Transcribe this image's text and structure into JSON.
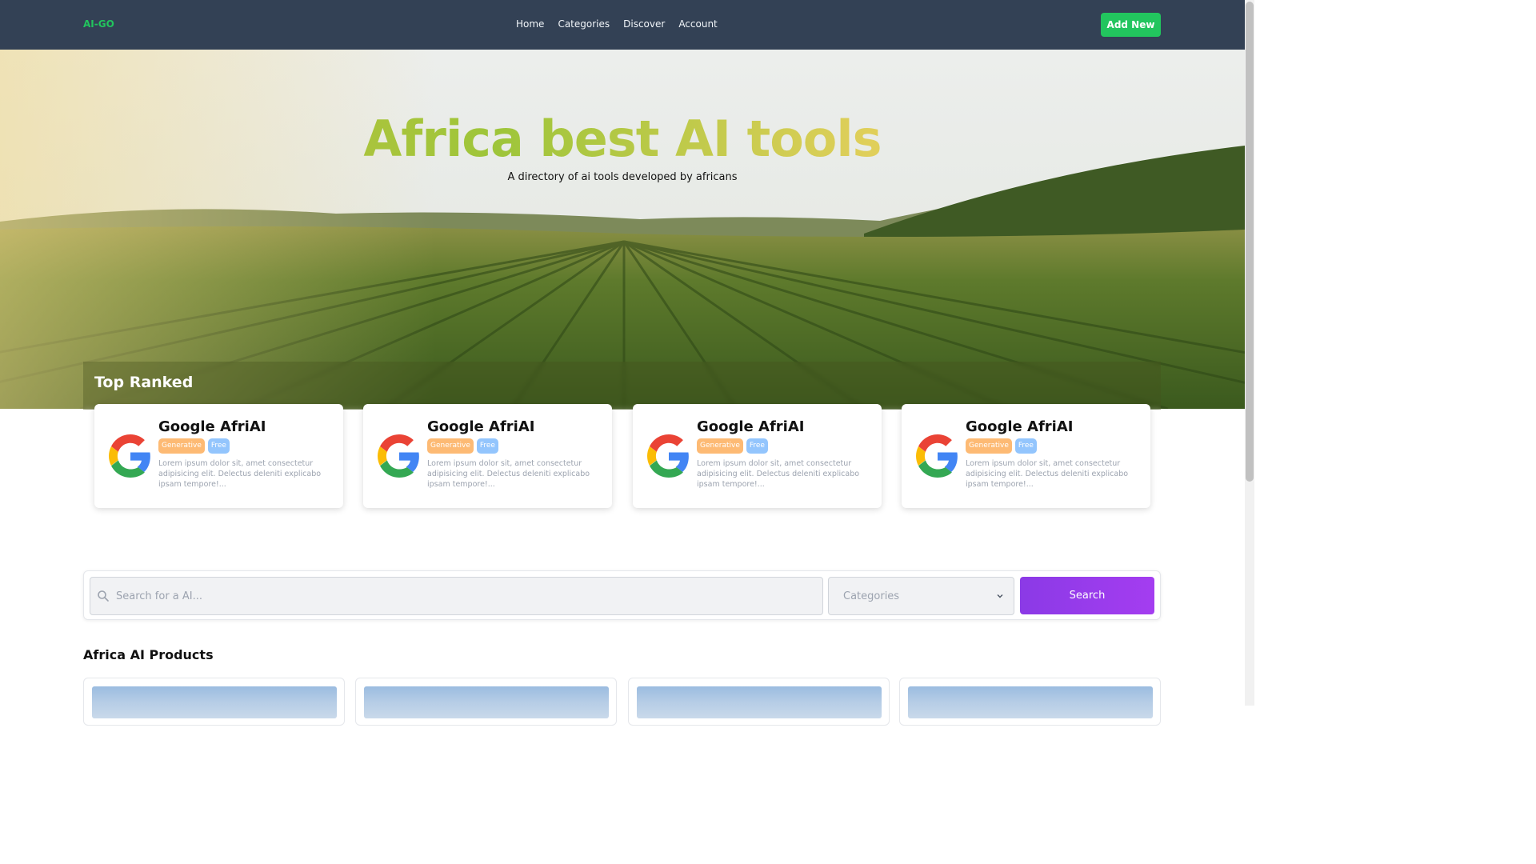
{
  "navbar": {
    "brand": "AI-GO",
    "links": [
      "Home",
      "Categories",
      "Discover",
      "Account"
    ],
    "add_button": "Add New"
  },
  "hero": {
    "title": "Africa best AI tools",
    "subtitle": "A directory of ai tools developed by africans"
  },
  "top_ranked": {
    "title": "Top Ranked",
    "cards": [
      {
        "name": "Google AfriAI",
        "tags": [
          "Generative",
          "Free"
        ],
        "description": "Lorem ipsum dolor sit, amet consectetur adipisicing elit. Delectus deleniti explicabo ipsam tempore!..."
      },
      {
        "name": "Google AfriAI",
        "tags": [
          "Generative",
          "Free"
        ],
        "description": "Lorem ipsum dolor sit, amet consectetur adipisicing elit. Delectus deleniti explicabo ipsam tempore!..."
      },
      {
        "name": "Google AfriAI",
        "tags": [
          "Generative",
          "Free"
        ],
        "description": "Lorem ipsum dolor sit, amet consectetur adipisicing elit. Delectus deleniti explicabo ipsam tempore!..."
      },
      {
        "name": "Google AfriAI",
        "tags": [
          "Generative",
          "Free"
        ],
        "description": "Lorem ipsum dolor sit, amet consectetur adipisicing elit. Delectus deleniti explicabo ipsam tempore!..."
      }
    ]
  },
  "search": {
    "placeholder": "Search for a AI...",
    "category_placeholder": "Categories",
    "button": "Search"
  },
  "products": {
    "title": "Africa AI Products"
  },
  "colors": {
    "navbar": "#334155",
    "brand": "#22c55e",
    "add_button": "#22c55e",
    "search_button": "#9333ea",
    "tag_generative": "#fdba74",
    "tag_free": "#93c5fd"
  },
  "icons": {
    "card_logo": "google-logo-icon",
    "search": "search-icon",
    "select": "chevron-down-icon"
  }
}
